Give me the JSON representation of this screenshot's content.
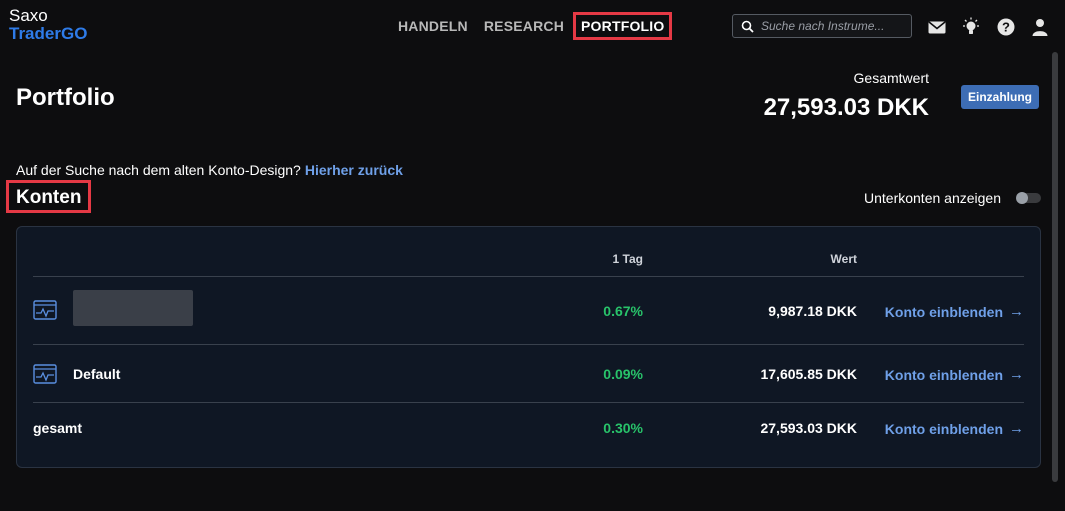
{
  "app": {
    "logo_line1": "Saxo",
    "logo_line2": "TraderGO"
  },
  "nav": {
    "items": [
      {
        "label": "HANDELN"
      },
      {
        "label": "RESEARCH"
      },
      {
        "label": "PORTFOLIO",
        "active": true
      }
    ]
  },
  "search": {
    "placeholder": "Suche nach Instrume..."
  },
  "header_icons": [
    "mail-icon",
    "lightbulb-icon",
    "help-icon",
    "user-icon"
  ],
  "page": {
    "title": "Portfolio",
    "total_label": "Gesamtwert",
    "total_value": "27,593.03 DKK",
    "deposit_button": "Einzahlung",
    "old_design_text": "Auf der Suche nach dem alten Konto-Design?",
    "old_design_link": "Hierher zurück"
  },
  "accounts": {
    "title": "Konten",
    "subaccounts_label": "Unterkonten anzeigen",
    "subaccounts_enabled": false,
    "columns": {
      "day": "1 Tag",
      "value": "Wert"
    },
    "rows": [
      {
        "name": "",
        "name_redacted": true,
        "day": "0.67%",
        "value": "9,987.18 DKK",
        "action": "Konto einblenden",
        "icon": "account-chart-icon"
      },
      {
        "name": "Default",
        "day": "0.09%",
        "value": "17,605.85 DKK",
        "action": "Konto einblenden",
        "icon": "account-chart-icon"
      },
      {
        "name": "gesamt",
        "day": "0.30%",
        "value": "27,593.03 DKK",
        "action": "Konto einblenden"
      }
    ]
  },
  "colors": {
    "background": "#0d0d0f",
    "brand_blue": "#2e7be8",
    "link_blue": "#6fa0e8",
    "positive_green": "#28c36a",
    "highlight_red": "#e53945",
    "button_blue": "#3d6db5"
  },
  "arrow_glyph": "→"
}
